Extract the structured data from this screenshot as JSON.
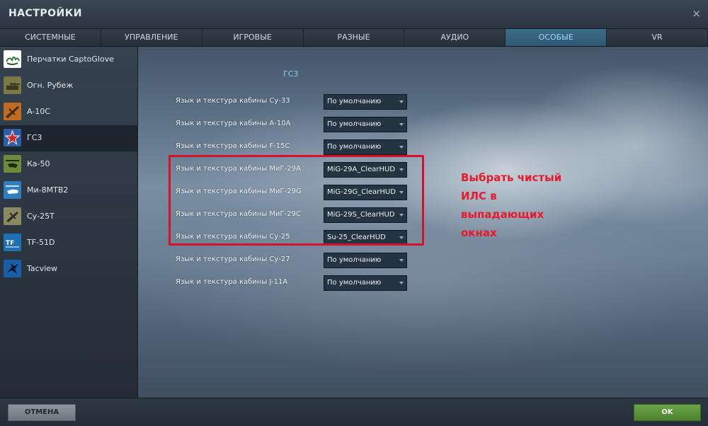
{
  "window": {
    "title": "НАСТРОЙКИ",
    "close_glyph": "×"
  },
  "tabs": [
    {
      "label": "СИСТЕМНЫЕ",
      "active": false
    },
    {
      "label": "УПРАВЛЕНИЕ",
      "active": false
    },
    {
      "label": "ИГРОВЫЕ",
      "active": false
    },
    {
      "label": "РАЗНЫЕ",
      "active": false
    },
    {
      "label": "АУДИО",
      "active": false
    },
    {
      "label": "ОСОБЫЕ",
      "active": true
    },
    {
      "label": "VR",
      "active": false
    }
  ],
  "sidebar": {
    "items": [
      {
        "label": "Перчатки CaptoGlove",
        "icon": "hand-logo-icon",
        "active": false
      },
      {
        "label": "Огн. Рубеж",
        "icon": "tank-icon",
        "active": false
      },
      {
        "label": "A-10C",
        "icon": "aircraft-a10-icon",
        "active": false
      },
      {
        "label": "ГС3",
        "icon": "red-star-icon",
        "active": true
      },
      {
        "label": "Ка-50",
        "icon": "helicopter-ka50-icon",
        "active": false
      },
      {
        "label": "Ми-8МТВ2",
        "icon": "helicopter-mi8-icon",
        "active": false
      },
      {
        "label": "Су-25Т",
        "icon": "aircraft-su25t-icon",
        "active": false
      },
      {
        "label": "TF-51D",
        "icon": "tf51d-logo-icon",
        "active": false
      },
      {
        "label": "Tacview",
        "icon": "tacview-bird-icon",
        "active": false
      }
    ]
  },
  "main": {
    "section_title": "ГС3",
    "settings": [
      {
        "label": "Язык и текстура кабины Су-33",
        "value": "По умолчанию"
      },
      {
        "label": "Язык и текстура кабины А-10А",
        "value": "По умолчанию"
      },
      {
        "label": "Язык и текстура кабины F-15C",
        "value": "По умолчанию"
      },
      {
        "label": "Язык и текстура кабины МиГ-29А",
        "value": "MiG-29A_ClearHUD"
      },
      {
        "label": "Язык и текстура кабины МиГ-29G",
        "value": "MiG-29G_ClearHUD"
      },
      {
        "label": "Язык и текстура кабины МиГ-29С",
        "value": "MiG-29S_ClearHUD"
      },
      {
        "label": "Язык и текстура кабины Су-25",
        "value": "Su-25_ClearHUD"
      },
      {
        "label": "Язык и текстура кабины Су-27",
        "value": "По умолчанию"
      },
      {
        "label": "Язык и текстура кабины J-11A",
        "value": "По умолчанию"
      }
    ],
    "annotation": "Выбрать чистый ИЛС в выпадающих окнах",
    "annotation_color": "#e61a2a"
  },
  "footer": {
    "cancel_label": "ОТМЕНА",
    "ok_label": "OK"
  },
  "colors": {
    "active_tab": "#3c6d8b",
    "section_title": "#8fd0ef",
    "ok_button": "#5a9a3c"
  }
}
